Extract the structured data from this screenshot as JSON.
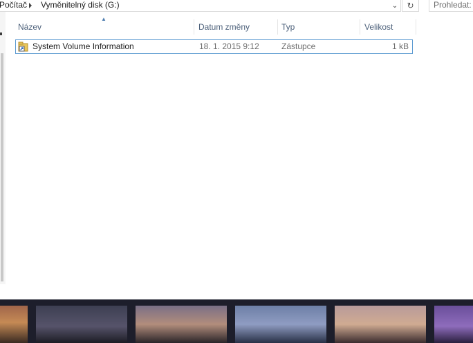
{
  "address_bar": {
    "breadcrumb": [
      "Počítač",
      "Vyměnitelný disk (G:)"
    ]
  },
  "search": {
    "placeholder": "Prohledat:"
  },
  "columns": [
    {
      "label": "Název"
    },
    {
      "label": "Datum změny"
    },
    {
      "label": "Typ"
    },
    {
      "label": "Velikost"
    }
  ],
  "files": [
    {
      "name": "System Volume Information",
      "date": "18. 1. 2015 9:12",
      "type": "Zástupce",
      "size": "1 kB",
      "icon": "shortcut-folder-icon"
    }
  ],
  "colors": {
    "selection_border": "#5d9bd1",
    "header_text": "#4c607a",
    "taskbar_dark": "#1d1e2b"
  }
}
